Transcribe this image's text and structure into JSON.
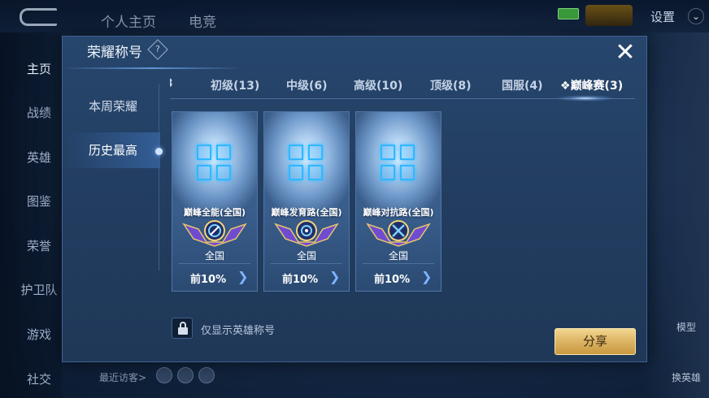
{
  "background": {
    "top_tabs": [
      "个人主页",
      "电竞"
    ],
    "settings_label": "设置",
    "nav_items": [
      "主页",
      "战绩",
      "英雄",
      "图鉴",
      "荣誉",
      "护卫队",
      "游戏",
      "社交"
    ],
    "side_buttons": [
      "模型",
      "换英雄"
    ],
    "recent_visitors_label": "最近访客>"
  },
  "modal": {
    "title": "荣耀称号",
    "help_glyph": "?",
    "close_glyph": "✕",
    "side_tabs": [
      {
        "label": "本周荣耀",
        "active": false
      },
      {
        "label": "历史最高",
        "active": true
      }
    ],
    "tabs": [
      {
        "label": "初级(13)",
        "active": false
      },
      {
        "label": "中级(6)",
        "active": false
      },
      {
        "label": "高级(10)",
        "active": false
      },
      {
        "label": "顶级(8)",
        "active": false
      },
      {
        "label": "国服(4)",
        "active": false
      },
      {
        "label": "巅峰赛(3)",
        "active": true
      }
    ],
    "tab_fragment": "3",
    "active_tab_icon": "diamond-icon",
    "cards": [
      {
        "name": "巅峰全能(全国)",
        "region": "全国",
        "rank": "前10%",
        "badge_icon": "allround-icon"
      },
      {
        "name": "巅峰发育路(全国)",
        "region": "全国",
        "rank": "前10%",
        "badge_icon": "marksman-icon"
      },
      {
        "name": "巅峰对抗路(全国)",
        "region": "全国",
        "rank": "前10%",
        "badge_icon": "clash-lane-icon"
      }
    ],
    "hero_only_label": "仅显示英雄称号",
    "share_label": "分享"
  },
  "colors": {
    "accent_gold": "#dcb464",
    "modal_bg": "#223d60",
    "ice_blue": "#2fb8ff",
    "badge_purple": "#6e4bd1"
  }
}
